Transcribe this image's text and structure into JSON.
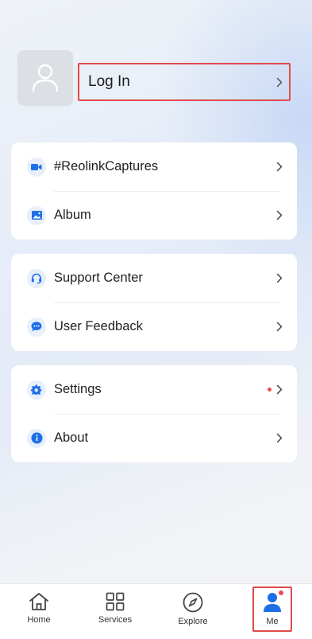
{
  "profile": {
    "login_label": "Log In"
  },
  "menu_groups": [
    {
      "items": [
        {
          "label": "#ReolinkCaptures",
          "icon": "video-camera-icon"
        },
        {
          "label": "Album",
          "icon": "image-icon"
        }
      ]
    },
    {
      "items": [
        {
          "label": "Support Center",
          "icon": "headset-icon"
        },
        {
          "label": "User Feedback",
          "icon": "chat-bubble-icon"
        }
      ]
    },
    {
      "items": [
        {
          "label": "Settings",
          "icon": "gear-icon",
          "badge_dot": true
        },
        {
          "label": "About",
          "icon": "info-icon"
        }
      ]
    }
  ],
  "tabbar": {
    "tabs": [
      {
        "label": "Home",
        "icon": "home-icon",
        "active": false
      },
      {
        "label": "Services",
        "icon": "grid-icon",
        "active": false
      },
      {
        "label": "Explore",
        "icon": "compass-icon",
        "active": false
      },
      {
        "label": "Me",
        "icon": "person-icon",
        "active": true,
        "badge_dot": true
      }
    ]
  },
  "colors": {
    "accent": "#1e6fe6",
    "icon_bg": "#e7effb",
    "badge": "#ef4b4b",
    "highlight_border": "#e04b4b"
  }
}
